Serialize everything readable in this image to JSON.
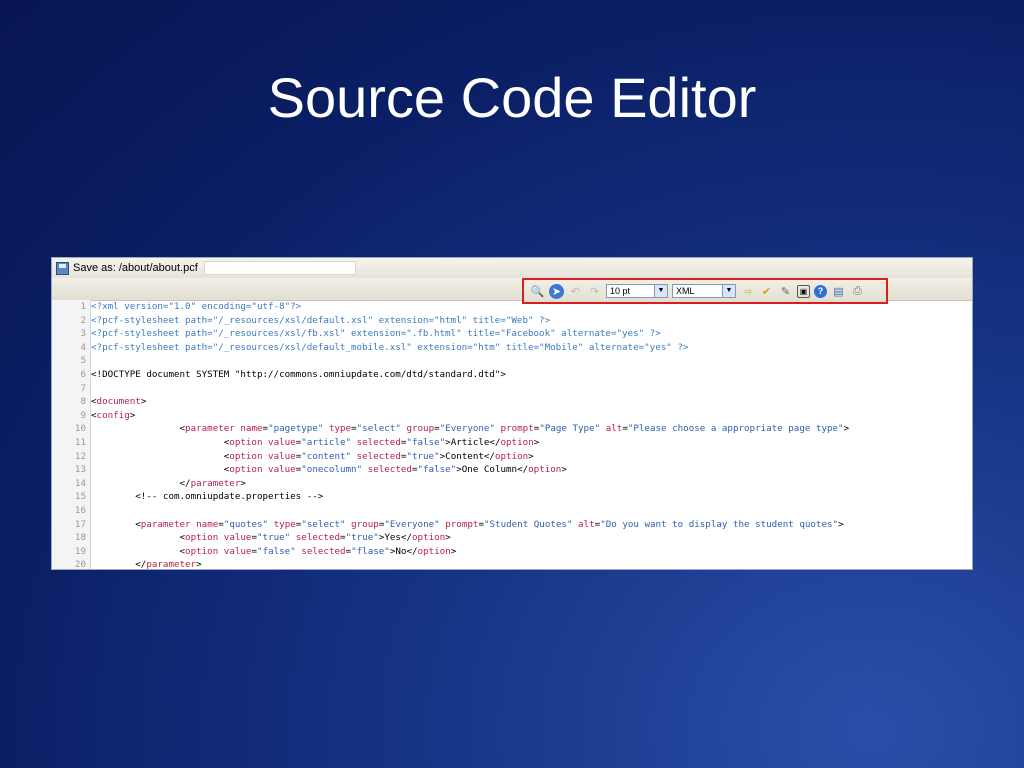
{
  "slide": {
    "title": "Source Code Editor"
  },
  "save_bar": {
    "label": "Save as: /about/about.pcf"
  },
  "toolbar": {
    "font_size": "10 pt",
    "language": "XML",
    "icons": [
      "binoculars-icon",
      "goto-icon",
      "undo-icon",
      "redo-icon",
      "format-icon",
      "check-icon",
      "eraser-icon",
      "fullscreen-icon",
      "help-icon",
      "save-icon",
      "print-icon"
    ]
  },
  "colors": {
    "processing_instruction": "#3a7bbf",
    "tag": "#b8234b",
    "value": "#2f5fb3",
    "highlight_box": "#d81f1f"
  },
  "code": {
    "lines": [
      {
        "n": "1",
        "segs": [
          [
            "pi",
            "<?xml version=\"1.0\" encoding=\"utf-8\"?>"
          ]
        ]
      },
      {
        "n": "2",
        "segs": [
          [
            "pi",
            "<?pcf-stylesheet path=\"/_resources/xsl/default.xsl\" extension=\"html\" title=\"Web\" ?>"
          ]
        ]
      },
      {
        "n": "3",
        "segs": [
          [
            "pi",
            "<?pcf-stylesheet path=\"/_resources/xsl/fb.xsl\" extension=\".fb.html\" title=\"Facebook\" alternate=\"yes\" ?>"
          ]
        ]
      },
      {
        "n": "4",
        "segs": [
          [
            "pi",
            "<?pcf-stylesheet path=\"/_resources/xsl/default_mobile.xsl\" extension=\"htm\" title=\"Mobile\" alternate=\"yes\" ?>"
          ]
        ]
      },
      {
        "n": "5",
        "segs": []
      },
      {
        "n": "6",
        "segs": [
          [
            "plain",
            "<!DOCTYPE document SYSTEM \"http://commons.omniupdate.com/dtd/standard.dtd\">"
          ]
        ]
      },
      {
        "n": "7",
        "segs": []
      },
      {
        "n": "8",
        "segs": [
          [
            "plain",
            "<"
          ],
          [
            "tag",
            "document"
          ],
          [
            "plain",
            ">"
          ]
        ]
      },
      {
        "n": "9",
        "segs": [
          [
            "plain",
            "<"
          ],
          [
            "tag",
            "config"
          ],
          [
            "plain",
            ">"
          ]
        ]
      },
      {
        "n": "10",
        "segs": [
          [
            "plain",
            "                <"
          ],
          [
            "tag",
            "parameter"
          ],
          [
            "plain",
            " "
          ],
          [
            "attr",
            "name"
          ],
          [
            "plain",
            "="
          ],
          [
            "val",
            "\"pagetype\""
          ],
          [
            "plain",
            " "
          ],
          [
            "attr",
            "type"
          ],
          [
            "plain",
            "="
          ],
          [
            "val",
            "\"select\""
          ],
          [
            "plain",
            " "
          ],
          [
            "attr",
            "group"
          ],
          [
            "plain",
            "="
          ],
          [
            "val",
            "\"Everyone\""
          ],
          [
            "plain",
            " "
          ],
          [
            "attr",
            "prompt"
          ],
          [
            "plain",
            "="
          ],
          [
            "val",
            "\"Page Type\""
          ],
          [
            "plain",
            " "
          ],
          [
            "attr",
            "alt"
          ],
          [
            "plain",
            "="
          ],
          [
            "val",
            "\"Please choose a appropriate page type\""
          ],
          [
            "plain",
            ">"
          ]
        ]
      },
      {
        "n": "11",
        "segs": [
          [
            "plain",
            "                        <"
          ],
          [
            "tag",
            "option"
          ],
          [
            "plain",
            " "
          ],
          [
            "attr",
            "value"
          ],
          [
            "plain",
            "="
          ],
          [
            "val",
            "\"article\""
          ],
          [
            "plain",
            " "
          ],
          [
            "attr",
            "selected"
          ],
          [
            "plain",
            "="
          ],
          [
            "val",
            "\"false\""
          ],
          [
            "plain",
            ">Article</"
          ],
          [
            "tag",
            "option"
          ],
          [
            "plain",
            ">"
          ]
        ]
      },
      {
        "n": "12",
        "segs": [
          [
            "plain",
            "                        <"
          ],
          [
            "tag",
            "option"
          ],
          [
            "plain",
            " "
          ],
          [
            "attr",
            "value"
          ],
          [
            "plain",
            "="
          ],
          [
            "val",
            "\"content\""
          ],
          [
            "plain",
            " "
          ],
          [
            "attr",
            "selected"
          ],
          [
            "plain",
            "="
          ],
          [
            "val",
            "\"true\""
          ],
          [
            "plain",
            ">Content</"
          ],
          [
            "tag",
            "option"
          ],
          [
            "plain",
            ">"
          ]
        ]
      },
      {
        "n": "13",
        "segs": [
          [
            "plain",
            "                        <"
          ],
          [
            "tag",
            "option"
          ],
          [
            "plain",
            " "
          ],
          [
            "attr",
            "value"
          ],
          [
            "plain",
            "="
          ],
          [
            "val",
            "\"onecolumn\""
          ],
          [
            "plain",
            " "
          ],
          [
            "attr",
            "selected"
          ],
          [
            "plain",
            "="
          ],
          [
            "val",
            "\"false\""
          ],
          [
            "plain",
            ">One Column</"
          ],
          [
            "tag",
            "option"
          ],
          [
            "plain",
            ">"
          ]
        ]
      },
      {
        "n": "14",
        "segs": [
          [
            "plain",
            "                </"
          ],
          [
            "tag",
            "parameter"
          ],
          [
            "plain",
            ">"
          ]
        ]
      },
      {
        "n": "15",
        "segs": [
          [
            "plain",
            "        <!-- com.omniupdate.properties -->"
          ]
        ]
      },
      {
        "n": "16",
        "segs": []
      },
      {
        "n": "17",
        "segs": [
          [
            "plain",
            "        <"
          ],
          [
            "tag",
            "parameter"
          ],
          [
            "plain",
            " "
          ],
          [
            "attr",
            "name"
          ],
          [
            "plain",
            "="
          ],
          [
            "val",
            "\"quotes\""
          ],
          [
            "plain",
            " "
          ],
          [
            "attr",
            "type"
          ],
          [
            "plain",
            "="
          ],
          [
            "val",
            "\"select\""
          ],
          [
            "plain",
            " "
          ],
          [
            "attr",
            "group"
          ],
          [
            "plain",
            "="
          ],
          [
            "val",
            "\"Everyone\""
          ],
          [
            "plain",
            " "
          ],
          [
            "attr",
            "prompt"
          ],
          [
            "plain",
            "="
          ],
          [
            "val",
            "\"Student Quotes\""
          ],
          [
            "plain",
            " "
          ],
          [
            "attr",
            "alt"
          ],
          [
            "plain",
            "="
          ],
          [
            "val",
            "\"Do you want to display the student quotes\""
          ],
          [
            "plain",
            ">"
          ]
        ]
      },
      {
        "n": "18",
        "segs": [
          [
            "plain",
            "                <"
          ],
          [
            "tag",
            "option"
          ],
          [
            "plain",
            " "
          ],
          [
            "attr",
            "value"
          ],
          [
            "plain",
            "="
          ],
          [
            "val",
            "\"true\""
          ],
          [
            "plain",
            " "
          ],
          [
            "attr",
            "selected"
          ],
          [
            "plain",
            "="
          ],
          [
            "val",
            "\"true\""
          ],
          [
            "plain",
            ">Yes</"
          ],
          [
            "tag",
            "option"
          ],
          [
            "plain",
            ">"
          ]
        ]
      },
      {
        "n": "19",
        "segs": [
          [
            "plain",
            "                <"
          ],
          [
            "tag",
            "option"
          ],
          [
            "plain",
            " "
          ],
          [
            "attr",
            "value"
          ],
          [
            "plain",
            "="
          ],
          [
            "val",
            "\"false\""
          ],
          [
            "plain",
            " "
          ],
          [
            "attr",
            "selected"
          ],
          [
            "plain",
            "="
          ],
          [
            "val",
            "\"flase\""
          ],
          [
            "plain",
            ">No</"
          ],
          [
            "tag",
            "option"
          ],
          [
            "plain",
            ">"
          ]
        ]
      },
      {
        "n": "20",
        "segs": [
          [
            "plain",
            "        </"
          ],
          [
            "tag",
            "parameter"
          ],
          [
            "plain",
            ">"
          ]
        ]
      }
    ]
  }
}
